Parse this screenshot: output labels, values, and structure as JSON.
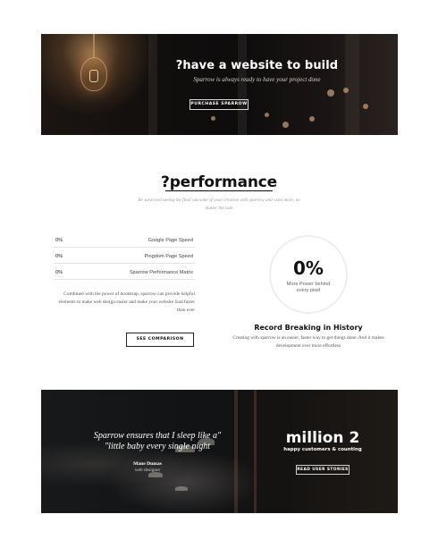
{
  "hero": {
    "title": "?have a website to build",
    "subtitle": "Sparrow is always ready to have your project done",
    "button_label": "PURCHASE SPARROW"
  },
  "performance": {
    "title": "?performance",
    "subtitle": "Be surprised seeing the final outcome of your creation with sparrow and want more, no matter the task",
    "metrics": [
      {
        "value": "0%",
        "label": "Google Page Speed",
        "level": 0
      },
      {
        "value": "0%",
        "label": "Pingdom Page Speed",
        "level": 0
      },
      {
        "value": "0%",
        "label": "Sparrow Performance Matrix",
        "level": 0
      }
    ],
    "description": "Combined with the power of bootstrap, sparrow can provide helpful elements to make web design easier and make your website load faster than ever",
    "button_label": "SEE COMPARISON",
    "circle_value": "0%",
    "circle_label": "More Power behind every pixel",
    "record_title": "Record Breaking in History",
    "record_text": "Creating with sparrow is an easier, faster way to get things done. And it makes development ever more effortless"
  },
  "testimonial": {
    "quote": "Sparrow ensures that I sleep like a\" \"little baby every single night",
    "author": "Mane Dumas",
    "role": "web designer",
    "stat_value": "million 2",
    "stat_label": "happy customers & counting",
    "button_label": "READ USER STORIES"
  },
  "colors": {
    "page_background": "#ffffff",
    "banner_dark": "#121212",
    "heading": "#111111"
  }
}
